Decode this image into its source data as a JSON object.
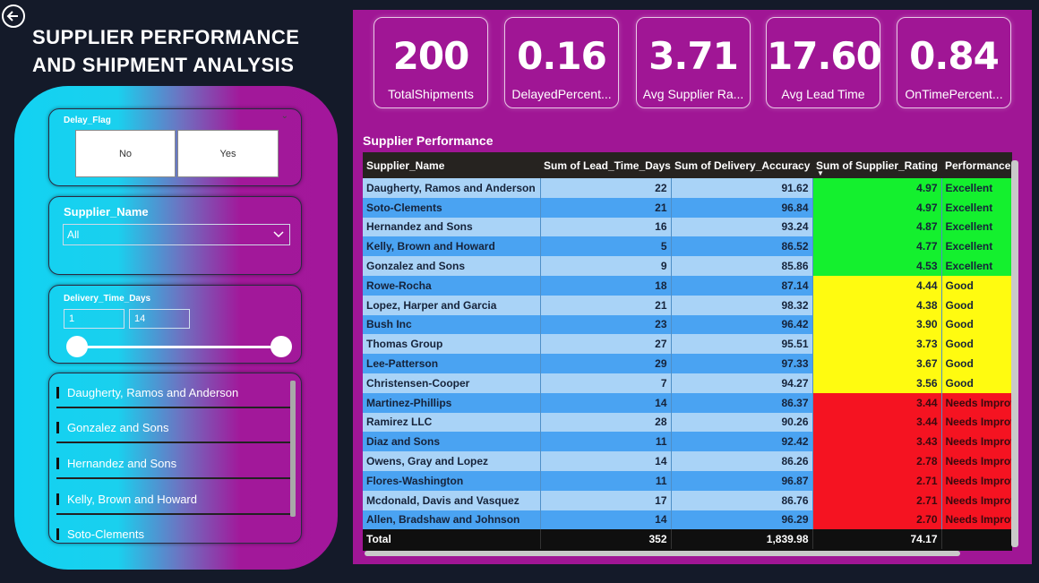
{
  "header": {
    "title": "SUPPLIER PERFORMANCE AND SHIPMENT ANALYSIS"
  },
  "icons": {
    "back": "arrow-left-circle-icon",
    "chevron": "chevron-down-icon"
  },
  "slicers": {
    "delay_flag": {
      "title": "Delay_Flag",
      "options": [
        "No",
        "Yes"
      ]
    },
    "supplier_name": {
      "title": "Supplier_Name",
      "selected": "All"
    },
    "delivery_time": {
      "title": "Delivery_Time_Days",
      "min_value": "1",
      "max_value": "14"
    },
    "supplier_list": [
      "Daugherty, Ramos and Anderson",
      "Gonzalez and Sons",
      "Hernandez and Sons",
      "Kelly, Brown and Howard",
      "Soto-Clements"
    ]
  },
  "kpis": [
    {
      "value": "200",
      "label": "TotalShipments"
    },
    {
      "value": "0.16",
      "label": "DelayedPercent..."
    },
    {
      "value": "3.71",
      "label": "Avg Supplier Ra..."
    },
    {
      "value": "17.60",
      "label": "Avg Lead Time"
    },
    {
      "value": "0.84",
      "label": "OnTimePercent..."
    }
  ],
  "table": {
    "title": "Supplier Performance",
    "headers": [
      "Supplier_Name",
      "Sum of Lead_Time_Days",
      "Sum of Delivery_Accuracy",
      "Sum of Supplier_Rating",
      "Performance"
    ],
    "rows": [
      [
        "Daugherty, Ramos and Anderson",
        "22",
        "91.62",
        "4.97",
        "Excellent"
      ],
      [
        "Soto-Clements",
        "21",
        "96.84",
        "4.97",
        "Excellent"
      ],
      [
        "Hernandez and Sons",
        "16",
        "93.24",
        "4.87",
        "Excellent"
      ],
      [
        "Kelly, Brown and Howard",
        "5",
        "86.52",
        "4.77",
        "Excellent"
      ],
      [
        "Gonzalez and Sons",
        "9",
        "85.86",
        "4.53",
        "Excellent"
      ],
      [
        "Rowe-Rocha",
        "18",
        "87.14",
        "4.44",
        "Good"
      ],
      [
        "Lopez, Harper and Garcia",
        "21",
        "98.32",
        "4.38",
        "Good"
      ],
      [
        "Bush Inc",
        "23",
        "96.42",
        "3.90",
        "Good"
      ],
      [
        "Thomas Group",
        "27",
        "95.51",
        "3.73",
        "Good"
      ],
      [
        "Lee-Patterson",
        "29",
        "97.33",
        "3.67",
        "Good"
      ],
      [
        "Christensen-Cooper",
        "7",
        "94.27",
        "3.56",
        "Good"
      ],
      [
        "Martinez-Phillips",
        "14",
        "86.37",
        "3.44",
        "Needs Improvement"
      ],
      [
        "Ramirez LLC",
        "28",
        "90.26",
        "3.44",
        "Needs Improvement"
      ],
      [
        "Diaz and Sons",
        "11",
        "92.42",
        "3.43",
        "Needs Improvement"
      ],
      [
        "Owens, Gray and Lopez",
        "14",
        "86.26",
        "2.78",
        "Needs Improvement"
      ],
      [
        "Flores-Washington",
        "11",
        "96.87",
        "2.71",
        "Needs Improvement"
      ],
      [
        "Mcdonald, Davis and Vasquez",
        "17",
        "86.76",
        "2.71",
        "Needs Improvement"
      ],
      [
        "Allen, Bradshaw and Johnson",
        "14",
        "96.29",
        "2.70",
        "Needs Improvement"
      ]
    ],
    "total": [
      "Total",
      "352",
      "1,839.98",
      "74.17",
      ""
    ]
  },
  "colors": {
    "excellent": "#14f02e",
    "good": "#fffb10",
    "needs_improvement": "#f51321",
    "panel": "#a01695"
  }
}
